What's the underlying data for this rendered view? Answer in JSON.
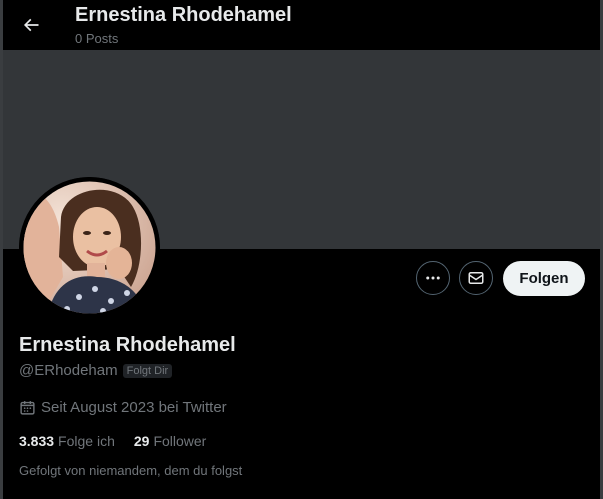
{
  "header": {
    "title": "Ernestina Rhodehamel",
    "posts_count": "0 Posts",
    "back_icon": "arrow-left-icon"
  },
  "profile": {
    "display_name": "Ernestina Rhodehamel",
    "handle": "@ERhodeham",
    "follows_you_badge": "Folgt Dir",
    "joined_text": "Seit August 2023 bei Twitter",
    "joined_icon": "calendar-icon",
    "following_count": "3.833",
    "following_label": "Folge ich",
    "followers_count": "29",
    "followers_label": "Follower",
    "followed_by_text": "Gefolgt von niemandem, dem du folgst"
  },
  "actions": {
    "more_icon": "more-horizontal-icon",
    "message_icon": "mail-icon",
    "follow_label": "Folgen"
  },
  "colors": {
    "background": "#000000",
    "banner": "#333639",
    "text_primary": "#e7e9ea",
    "text_secondary": "#71767b",
    "button_light": "#eff3f4"
  }
}
